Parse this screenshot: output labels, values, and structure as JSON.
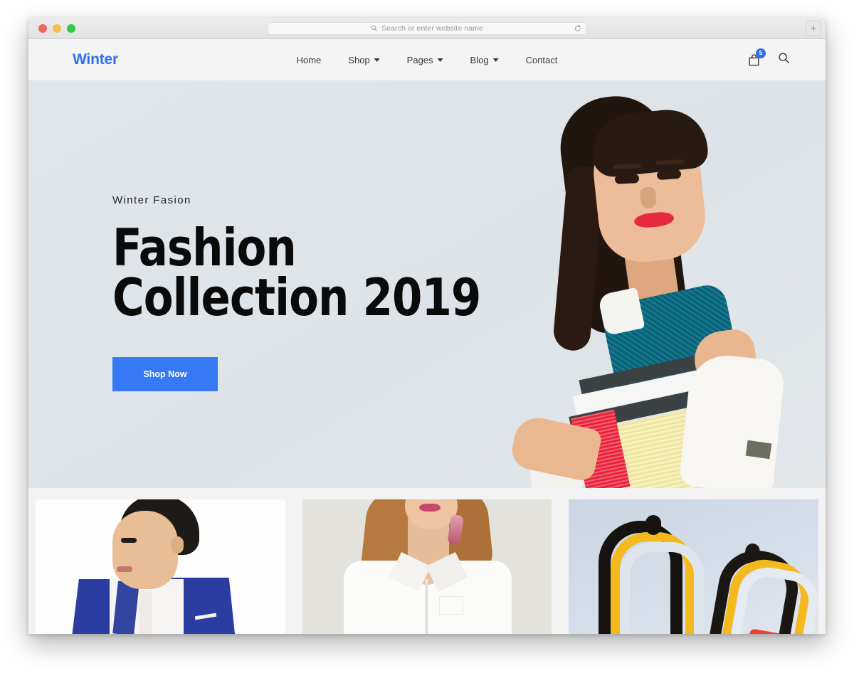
{
  "browser": {
    "traffic_lights": [
      {
        "name": "close",
        "color": "#f0655c"
      },
      {
        "name": "minimize",
        "color": "#f4bf4f"
      },
      {
        "name": "maximize",
        "color": "#2ecc41"
      }
    ],
    "url_bar": {
      "value": "",
      "placeholder": "Search or enter website name"
    },
    "new_tab_label": "+",
    "icons": {
      "search": "search-icon",
      "reload": "reload-icon",
      "new_tab": "plus-icon"
    }
  },
  "site": {
    "logo": "Winter",
    "logo_color": "#2f6ef0",
    "nav": [
      {
        "label": "Home",
        "has_dropdown": false
      },
      {
        "label": "Shop",
        "has_dropdown": true
      },
      {
        "label": "Pages",
        "has_dropdown": true
      },
      {
        "label": "Blog",
        "has_dropdown": true
      },
      {
        "label": "Contact",
        "has_dropdown": false
      }
    ],
    "actions": {
      "cart_icon": "shopping-bag-icon",
      "cart_badge_count": "5",
      "cart_badge_color": "#2f6ef0",
      "search_icon": "search-icon"
    }
  },
  "hero": {
    "eyebrow": "Winter Fasion",
    "title": "Fashion\nCollection 2019",
    "cta_label": "Shop Now",
    "cta_color": "#3579f6",
    "background_color": "#dfe4e9",
    "image_alt": "fashion-model-photo"
  },
  "categories": [
    {
      "name": "mens-suit-category",
      "image_alt": "man-in-blue-suit"
    },
    {
      "name": "womens-shirt-category",
      "image_alt": "woman-in-white-shirt"
    },
    {
      "name": "footwear-category",
      "image_alt": "sneakers-pair"
    }
  ]
}
